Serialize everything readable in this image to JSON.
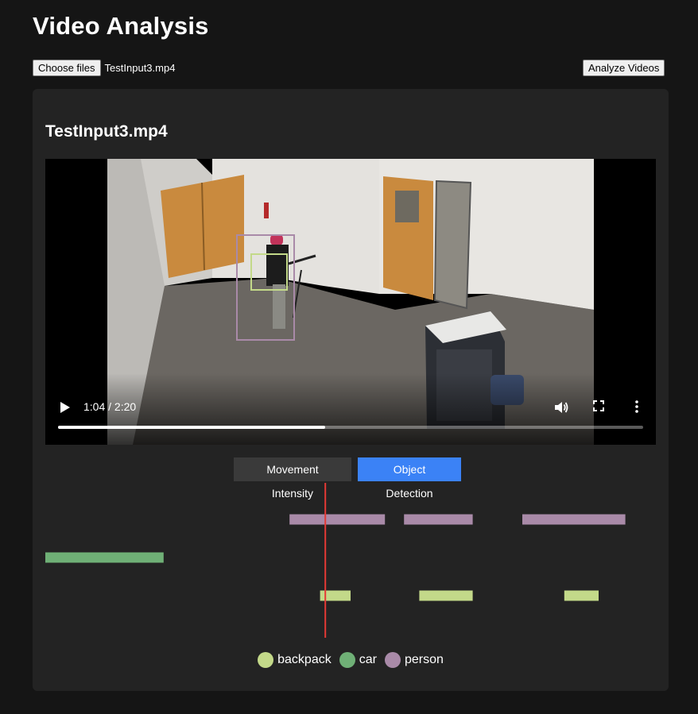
{
  "header": {
    "title": "Video Analysis"
  },
  "file_input": {
    "button_label": "Choose files",
    "selected_file": "TestInput3.mp4"
  },
  "toolbar": {
    "analyze_label": "Analyze Videos"
  },
  "card": {
    "title": "TestInput3.mp4",
    "video": {
      "current_time": "1:04 / 2:20",
      "progress_fraction": 0.457
    },
    "tabs": [
      {
        "label": "Movement Intensity",
        "active": false
      },
      {
        "label": "Object Detection",
        "active": true
      }
    ],
    "timeline": {
      "duration_sec": 140,
      "playhead_sec": 64,
      "tracks": [
        {
          "label": "person",
          "color": "#a98aa8",
          "segments": [
            [
              64,
              89
            ],
            [
              94,
              112
            ],
            [
              125,
              152
            ]
          ]
        },
        {
          "label": "car",
          "color": "#6fb076",
          "segments": [
            [
              0,
              31
            ]
          ]
        },
        {
          "label": "backpack",
          "color": "#c3d989",
          "segments": [
            [
              72,
              80
            ],
            [
              98,
              112
            ],
            [
              136,
              145
            ]
          ]
        }
      ]
    },
    "legend": [
      {
        "label": "backpack",
        "color": "#c3d989"
      },
      {
        "label": "car",
        "color": "#6fb076"
      },
      {
        "label": "person",
        "color": "#a98aa8"
      }
    ]
  },
  "colors": {
    "accent": "#3b82f6",
    "playhead": "#e53935"
  }
}
